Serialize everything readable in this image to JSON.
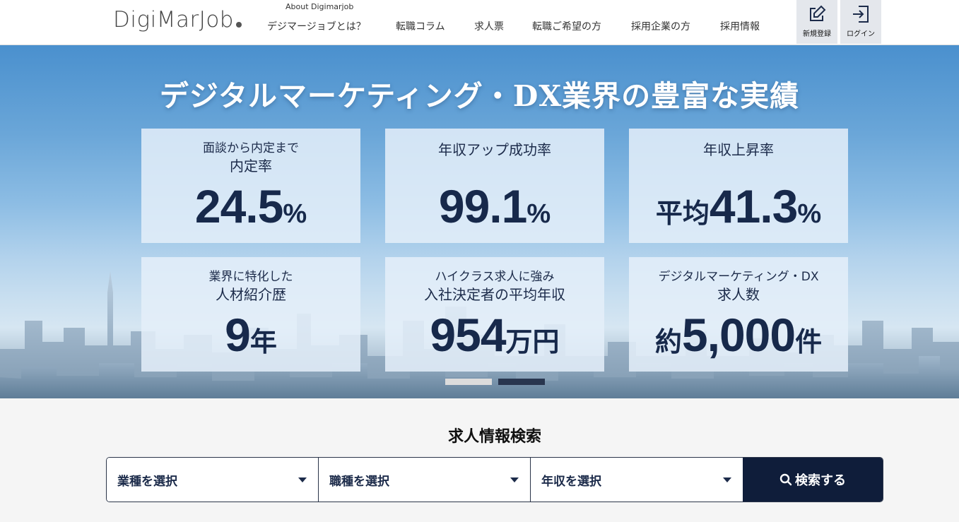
{
  "header": {
    "logo": "DigiMarJob",
    "about": "About Digimarjob",
    "nav": [
      "デジマージョブとは？",
      "転職コラム",
      "求人票",
      "転職ご希望の方",
      "採用企業の方",
      "採用情報"
    ],
    "register_label": "新規登録",
    "login_label": "ログイン"
  },
  "hero": {
    "title": "デジタルマーケティング・DX業界の豊富な実績",
    "cards": [
      {
        "line1": "面談から内定まで",
        "line2": "内定率",
        "prefix": "",
        "number": "24.5",
        "suffix": "%"
      },
      {
        "line1": "年収アップ成功率",
        "line2": "",
        "prefix": "",
        "number": "99.1",
        "suffix": "%"
      },
      {
        "line1": "年収上昇率",
        "line2": "",
        "prefix": "平均",
        "number": "41.3",
        "suffix": "%"
      },
      {
        "line1": "業界に特化した",
        "line2": "人材紹介歴",
        "prefix": "",
        "number": "9",
        "suffix": "年"
      },
      {
        "line1": "ハイクラス求人に強み",
        "line2": "入社決定者の平均年収",
        "prefix": "",
        "number": "954",
        "suffix": "万円"
      },
      {
        "line1": "デジタルマーケティング・DX",
        "line2": "求人数",
        "prefix": "約",
        "number": "5,000",
        "suffix": "件"
      }
    ],
    "carousel": {
      "count": 2,
      "active_index": 1
    }
  },
  "search": {
    "title": "求人情報検索",
    "industry_label": "業種を選択",
    "job_label": "職種を選択",
    "salary_label": "年収を選択",
    "button_label": "検索する"
  },
  "colors": {
    "navy": "#0f1d3a",
    "card_text": "#1c2b4a",
    "header_button_bg": "#e4e7ec",
    "dot_inactive": "#dcdcdc",
    "dot_active": "#29364f"
  }
}
